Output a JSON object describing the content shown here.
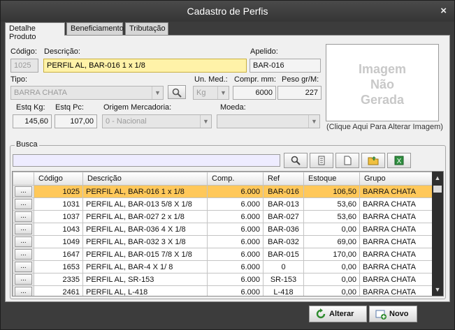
{
  "window": {
    "title": "Cadastro de Perfis",
    "close_glyph": "×"
  },
  "tabs": [
    {
      "label": "Detalhe Produto"
    },
    {
      "label": "Beneficiamento"
    },
    {
      "label": "Tributação"
    }
  ],
  "form": {
    "codigo_label": "Código:",
    "codigo_value": "1025",
    "descricao_label": "Descrição:",
    "descricao_value": "PERFIL AL, BAR-016 1 x 1/8",
    "apelido_label": "Apelido:",
    "apelido_value": "BAR-016",
    "tipo_label": "Tipo:",
    "tipo_value": "BARRA CHATA",
    "unmed_label": "Un. Med.:",
    "unmed_value": "Kg",
    "compr_label": "Compr. mm:",
    "compr_value": "6000",
    "peso_label": "Peso gr/M:",
    "peso_value": "227",
    "estqkg_label": "Estq Kg:",
    "estqkg_value": "145,60",
    "estqpc_label": "Estq Pc:",
    "estqpc_value": "107,00",
    "origem_label": "Origem Mercadoria:",
    "origem_value": "0 - Nacional",
    "moeda_label": "Moeda:",
    "moeda_value": ""
  },
  "image": {
    "line1": "Imagem",
    "line2": "Não",
    "line3": "Gerada",
    "caption": "(Clique Aqui Para Alterar Imagem)"
  },
  "busca": {
    "legend": "Busca",
    "placeholder": "",
    "toolbar_icons": [
      "search-icon",
      "filter-icon",
      "new-document-icon",
      "folder-icon",
      "excel-icon"
    ]
  },
  "grid": {
    "columns": [
      "",
      "Código",
      "Descrição",
      "Comp.",
      "Ref",
      "Estoque",
      "Grupo"
    ],
    "row_button": "...",
    "rows": [
      {
        "codigo": "1025",
        "descricao": "PERFIL AL, BAR-016 1 x 1/8",
        "comp": "6.000",
        "ref": "BAR-016",
        "estoque": "106,50",
        "grupo": "BARRA CHATA",
        "selected": true
      },
      {
        "codigo": "1031",
        "descricao": "PERFIL AL, BAR-013 5/8 X 1/8",
        "comp": "6.000",
        "ref": "BAR-013",
        "estoque": "53,60",
        "grupo": "BARRA CHATA"
      },
      {
        "codigo": "1037",
        "descricao": "PERFIL AL, BAR-027 2 x 1/8",
        "comp": "6.000",
        "ref": "BAR-027",
        "estoque": "53,60",
        "grupo": "BARRA CHATA"
      },
      {
        "codigo": "1043",
        "descricao": "PERFIL AL, BAR-036  4 X 1/8",
        "comp": "6.000",
        "ref": "BAR-036",
        "estoque": "0,00",
        "grupo": "BARRA CHATA"
      },
      {
        "codigo": "1049",
        "descricao": "PERFIL AL, BAR-032  3 X 1/8",
        "comp": "6.000",
        "ref": "BAR-032",
        "estoque": "69,00",
        "grupo": "BARRA CHATA"
      },
      {
        "codigo": "1647",
        "descricao": "PERFIL AL, BAR-015 7/8 X 1/8",
        "comp": "6.000",
        "ref": "BAR-015",
        "estoque": "170,00",
        "grupo": "BARRA CHATA"
      },
      {
        "codigo": "1653",
        "descricao": "PERFIL AL, BAR-4 X 1/ 8",
        "comp": "6.000",
        "ref": "0",
        "estoque": "0,00",
        "grupo": "BARRA CHATA"
      },
      {
        "codigo": "2335",
        "descricao": "PERFIL AL, SR-153",
        "comp": "6.000",
        "ref": "SR-153",
        "estoque": "0,00",
        "grupo": "BARRA CHATA"
      },
      {
        "codigo": "2461",
        "descricao": "PERFIL AL, L-418",
        "comp": "6.000",
        "ref": "L-418",
        "estoque": "0,00",
        "grupo": "BARRA CHATA"
      }
    ]
  },
  "footer": {
    "alterar_label": "Alterar",
    "novo_label": "Novo"
  },
  "colors": {
    "selected_row": "#ffc85a",
    "highlight_field": "#fff2a8",
    "titlebar": "#3c3c3c"
  }
}
